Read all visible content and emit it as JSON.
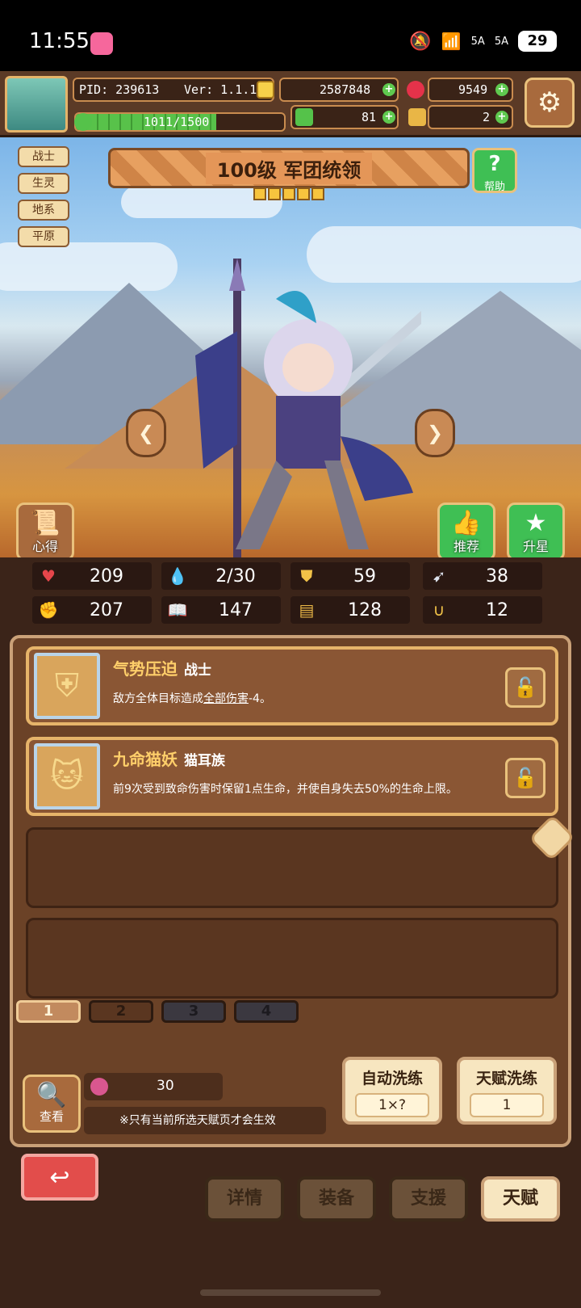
{
  "status_bar": {
    "time": "11:55",
    "network1": "5A",
    "network2": "5A",
    "battery": "29"
  },
  "player": {
    "pid": "PID: 239613",
    "version": "Ver: 1.1.1.2",
    "gold": "2587848",
    "gems": "9549",
    "exp": "1011/1500",
    "exp_fraction": 0.674,
    "clover": "81",
    "key": "2"
  },
  "hero": {
    "tags": [
      "战士",
      "生灵",
      "地系",
      "平原"
    ],
    "title": "100级  军团统领",
    "stars": 5,
    "help_label": "帮助",
    "insight_label": "心得",
    "recommend_label": "推荐",
    "upstar_label": "升星"
  },
  "stats": [
    {
      "icon": "heart-icon",
      "value": "209"
    },
    {
      "icon": "mana-drop-icon",
      "value": "2/30"
    },
    {
      "icon": "shield-icon",
      "value": "59"
    },
    {
      "icon": "wing-icon",
      "value": "38"
    },
    {
      "icon": "fist-icon",
      "value": "207"
    },
    {
      "icon": "book-icon",
      "value": "147"
    },
    {
      "icon": "armor-icon",
      "value": "128"
    },
    {
      "icon": "horseshoe-icon",
      "value": "12"
    }
  ],
  "talents": [
    {
      "name": "气势压迫",
      "type": "战士",
      "desc_pre": "敌方全体目标造成",
      "desc_link": "全部伤害",
      "desc_post": "-4。"
    },
    {
      "name": "九命猫妖",
      "type": "猫耳族",
      "desc_pre": "前9次受到致命伤害时保留1点生命，并使自身失去50%的生命上限。",
      "desc_link": "",
      "desc_post": ""
    }
  ],
  "pages": [
    "1",
    "2",
    "3",
    "4"
  ],
  "controls": {
    "view_label": "查看",
    "fruit_count": "30",
    "note": "※只有当前所选天赋页才会生效",
    "auto_wash_label": "自动洗练",
    "auto_wash_cost": "1×?",
    "talent_wash_label": "天赋洗练",
    "talent_wash_cost": "1"
  },
  "nav": {
    "details": "详情",
    "equip": "装备",
    "support": "支援",
    "talent": "天赋"
  }
}
